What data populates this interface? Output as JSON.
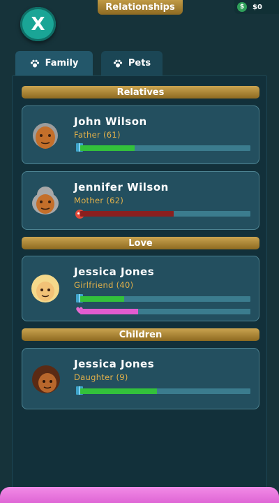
{
  "header": {
    "close_label": "X",
    "title": "Relationships",
    "money": "$0"
  },
  "tabs": [
    {
      "label": "Family",
      "icon": "paw-icon",
      "active": true
    },
    {
      "label": "Pets",
      "icon": "paw-icon",
      "active": false
    }
  ],
  "sections": {
    "relatives": "Relatives",
    "love": "Love",
    "children": "Children"
  },
  "people": [
    {
      "name": "John Wilson",
      "role": "Father (61)",
      "bars": [
        {
          "icon": "gift-icon",
          "value": 0.32,
          "color": "#33c13b"
        }
      ]
    },
    {
      "name": "Jennifer Wilson",
      "role": "Mother (62)",
      "bars": [
        {
          "icon": "angry-face-icon",
          "value": 0.55,
          "color": "#8a1f1f"
        }
      ]
    },
    {
      "name": "Jessica Jones",
      "role": "Girlfriend (40)",
      "bars": [
        {
          "icon": "gift-icon",
          "value": 0.26,
          "color": "#33c13b"
        },
        {
          "icon": "heart-icon",
          "value": 0.34,
          "color": "#e25cd0"
        }
      ]
    },
    {
      "name": "Jessica Jones",
      "role": "Daughter (9)",
      "bars": [
        {
          "icon": "gift-icon",
          "value": 0.45,
          "color": "#33c13b"
        }
      ]
    }
  ],
  "colors": {
    "background": "#16333a",
    "gold": "#b58e3a",
    "card": "#234f5f",
    "role_text": "#e3b14a"
  }
}
